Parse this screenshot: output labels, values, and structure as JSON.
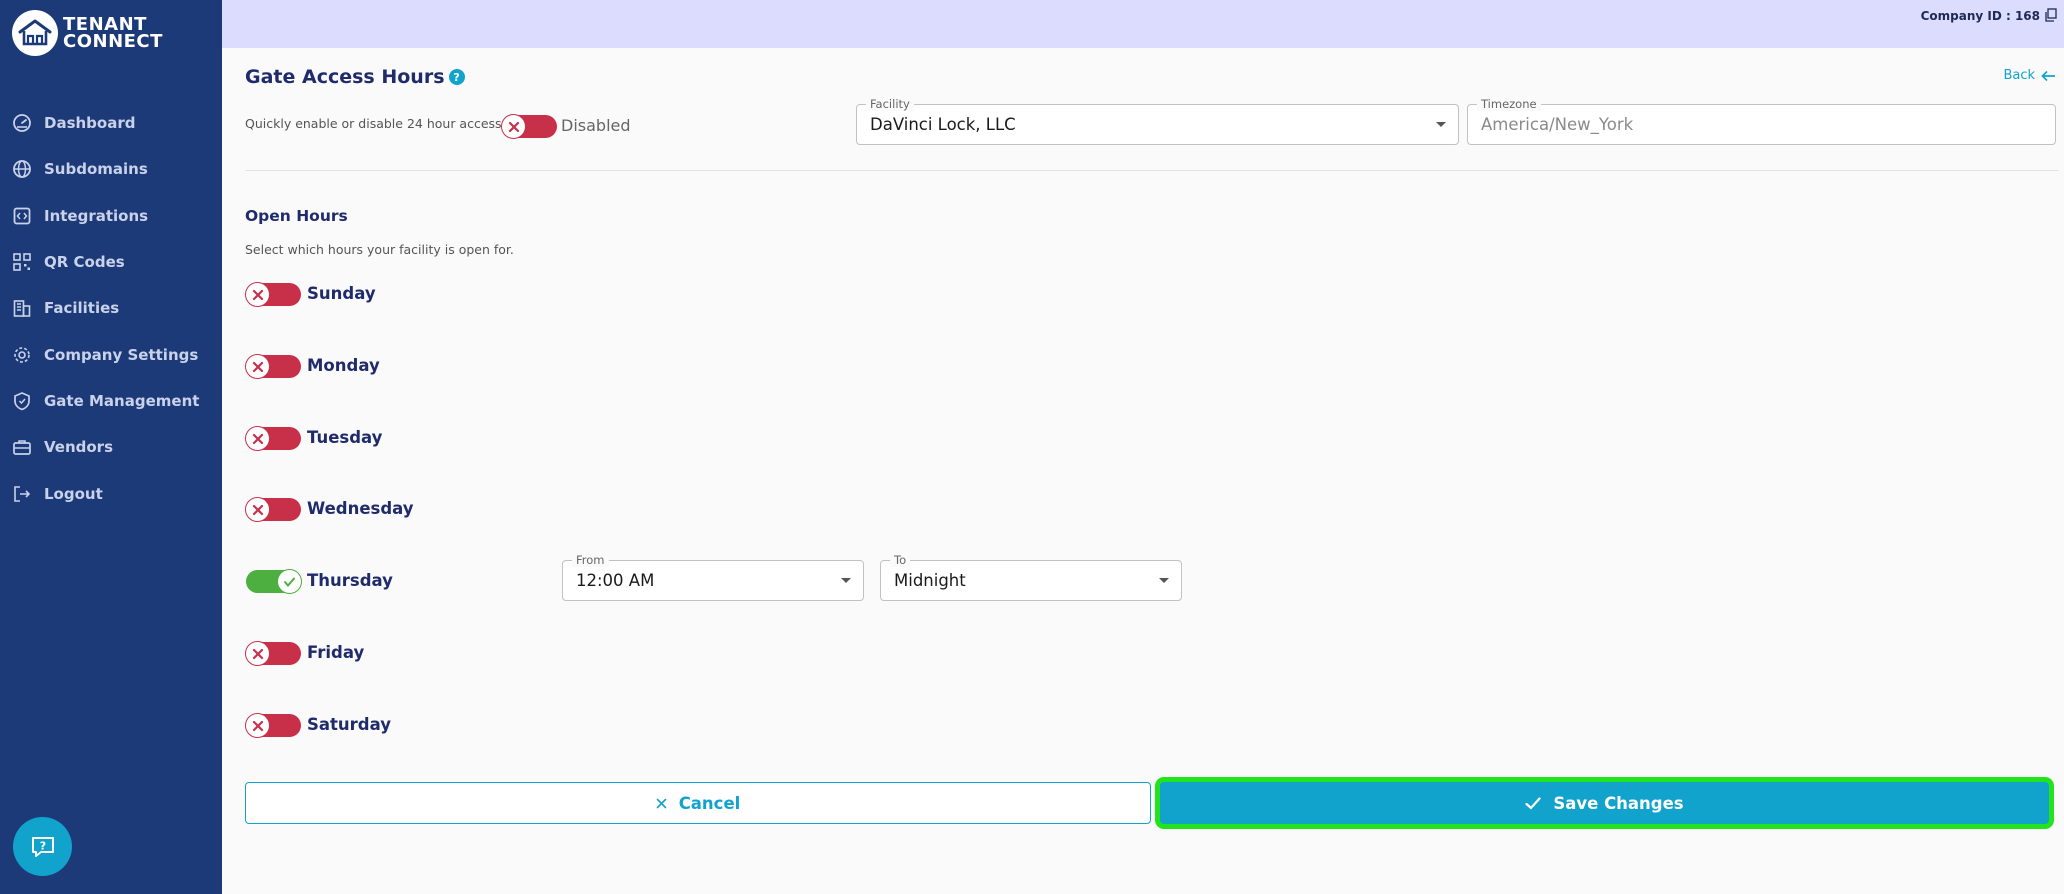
{
  "brand": {
    "name_line1": "TENANT",
    "name_line2": "CONNECT"
  },
  "sidebar": {
    "items": [
      {
        "label": "Dashboard",
        "icon": "gauge-icon"
      },
      {
        "label": "Subdomains",
        "icon": "globe-icon"
      },
      {
        "label": "Integrations",
        "icon": "code-icon"
      },
      {
        "label": "QR Codes",
        "icon": "qr-icon"
      },
      {
        "label": "Facilities",
        "icon": "building-icon"
      },
      {
        "label": "Company Settings",
        "icon": "gear-icon"
      },
      {
        "label": "Gate Management",
        "icon": "shield-icon"
      },
      {
        "label": "Vendors",
        "icon": "briefcase-icon"
      },
      {
        "label": "Logout",
        "icon": "logout-icon"
      }
    ]
  },
  "topbar": {
    "company_id": "Company ID : 168"
  },
  "page": {
    "title": "Gate Access Hours",
    "help_glyph": "?",
    "back_label": "Back",
    "quick_toggle_text": "Quickly enable or disable 24 hour access.",
    "quick_toggle_state": "Disabled"
  },
  "facility": {
    "label": "Facility",
    "value": "DaVinci Lock, LLC"
  },
  "timezone": {
    "label": "Timezone",
    "value": "America/New_York"
  },
  "open_hours": {
    "title": "Open Hours",
    "subtitle": "Select which hours your facility is open for.",
    "days": [
      {
        "label": "Sunday",
        "enabled": false
      },
      {
        "label": "Monday",
        "enabled": false
      },
      {
        "label": "Tuesday",
        "enabled": false
      },
      {
        "label": "Wednesday",
        "enabled": false
      },
      {
        "label": "Thursday",
        "enabled": true,
        "from_label": "From",
        "from": "12:00 AM",
        "to_label": "To",
        "to": "Midnight"
      },
      {
        "label": "Friday",
        "enabled": false
      },
      {
        "label": "Saturday",
        "enabled": false
      }
    ]
  },
  "actions": {
    "cancel_label": "Cancel",
    "save_label": "Save Changes"
  },
  "colors": {
    "sidebar": "#1c3a78",
    "accent": "#12a3cc",
    "off": "#c8304a",
    "on": "#4caf3f",
    "highlight": "#22e41c",
    "topbar": "#dcdcff"
  }
}
